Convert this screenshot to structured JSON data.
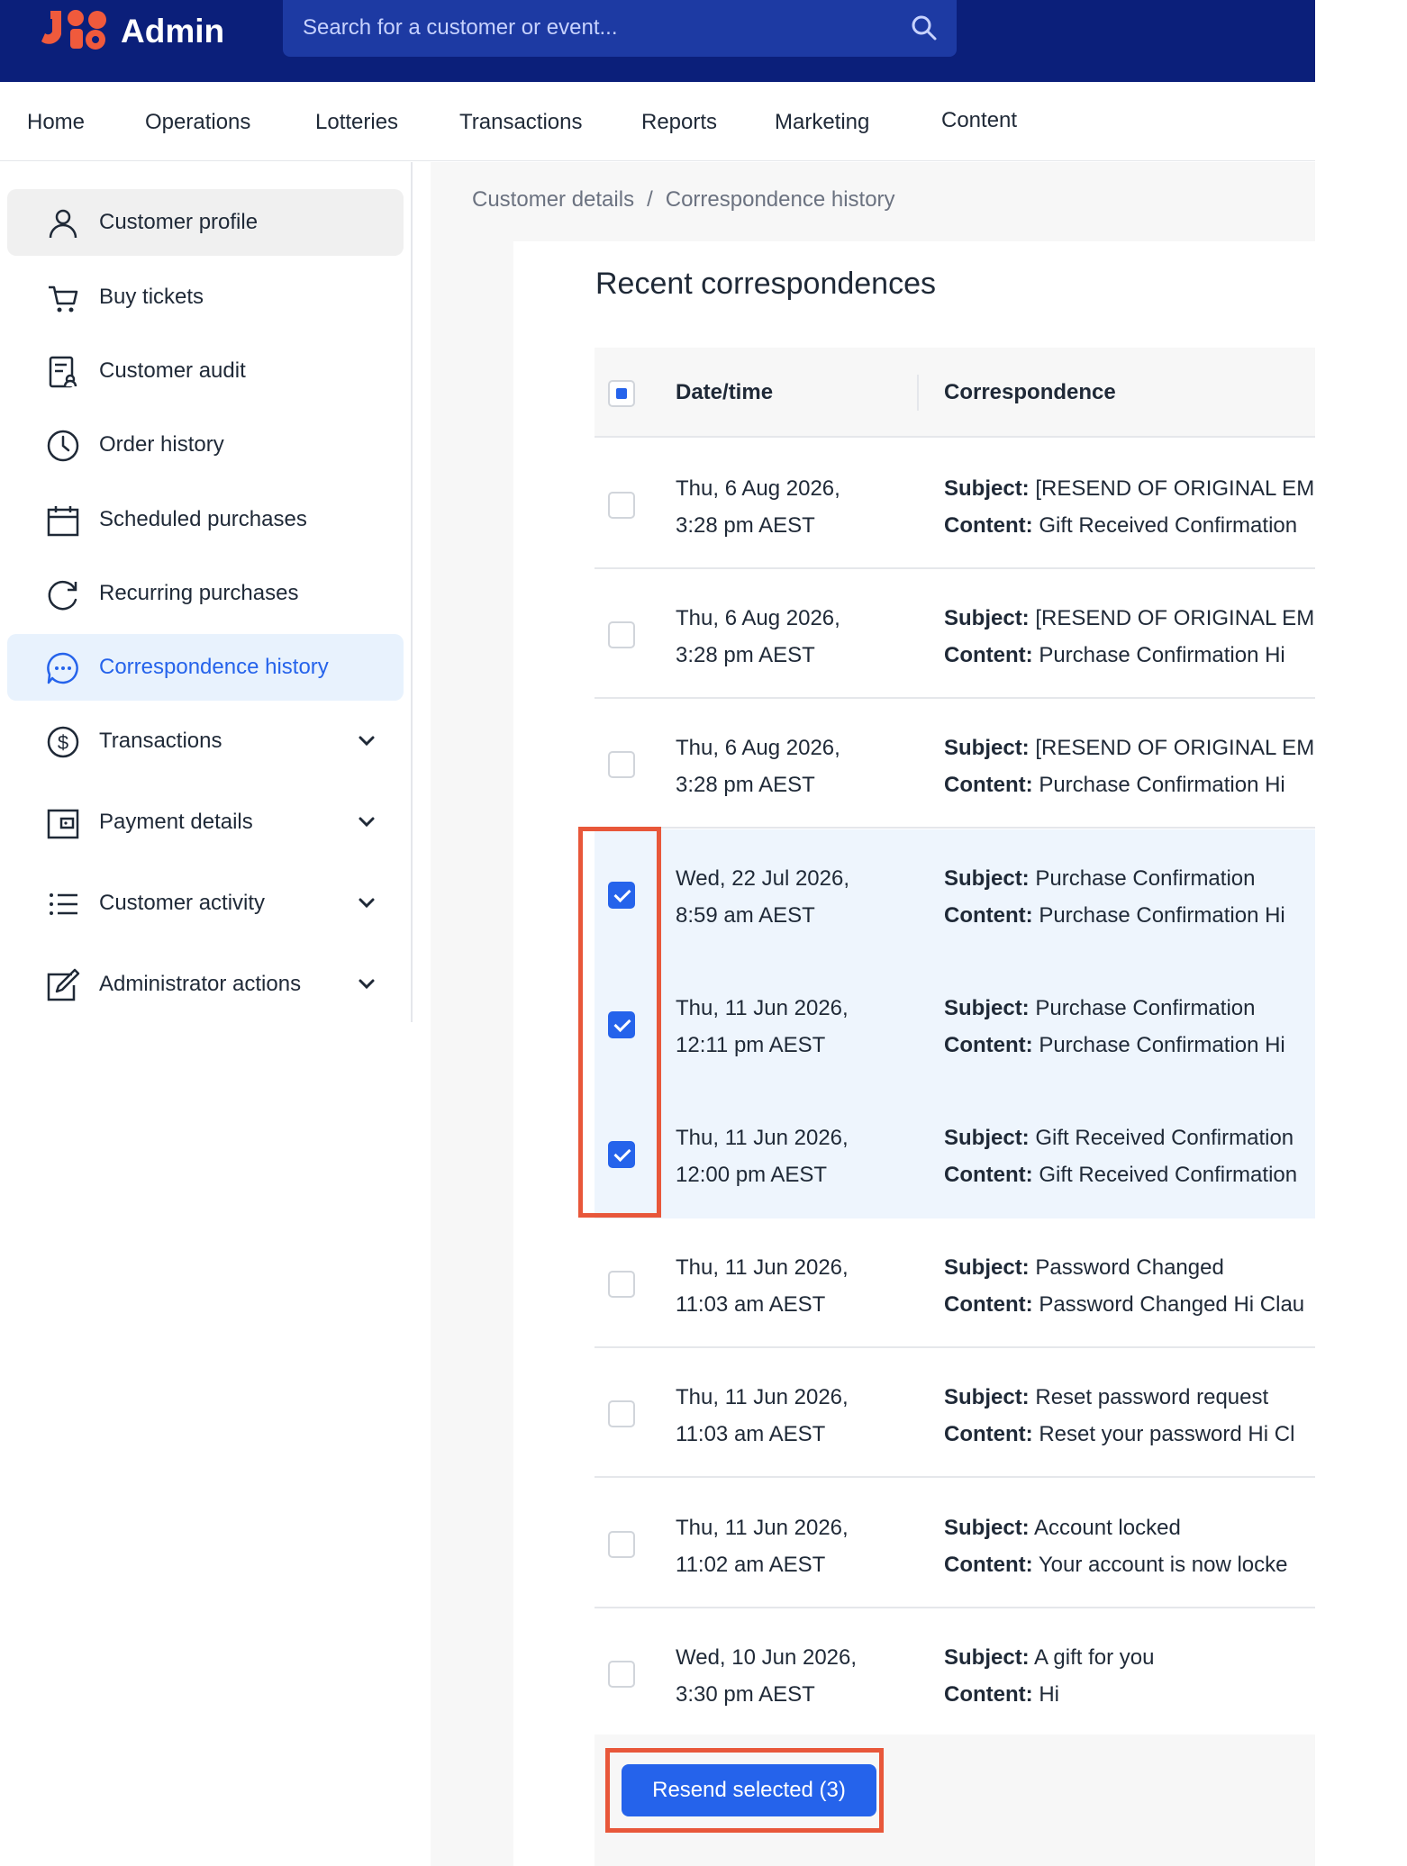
{
  "header": {
    "brand": "Admin",
    "search_placeholder": "Search for a customer or event..."
  },
  "nav": [
    "Home",
    "Operations",
    "Lotteries",
    "Transactions",
    "Reports",
    "Marketing",
    "Content"
  ],
  "sidebar": {
    "items": [
      {
        "label": "Customer profile",
        "icon": "user-icon"
      },
      {
        "label": "Buy tickets",
        "icon": "cart-icon"
      },
      {
        "label": "Customer audit",
        "icon": "audit-icon"
      },
      {
        "label": "Order history",
        "icon": "clock-icon"
      },
      {
        "label": "Scheduled purchases",
        "icon": "calendar-icon"
      },
      {
        "label": "Recurring purchases",
        "icon": "refresh-icon"
      },
      {
        "label": "Correspondence history",
        "icon": "chat-icon"
      },
      {
        "label": "Transactions",
        "icon": "dollar-icon"
      },
      {
        "label": "Payment details",
        "icon": "wallet-icon"
      },
      {
        "label": "Customer activity",
        "icon": "list-icon"
      },
      {
        "label": "Administrator actions",
        "icon": "edit-icon"
      }
    ]
  },
  "breadcrumb": {
    "parent": "Customer details",
    "separator": "/",
    "current": "Correspondence history"
  },
  "panel": {
    "title": "Recent correspondences",
    "columns": {
      "date": "Date/time",
      "correspondence": "Correspondence"
    },
    "subject_label": "Subject:",
    "content_label": "Content:",
    "rows": [
      {
        "date1": "Thu, 6 Aug 2026,",
        "date2": "3:28 pm AEST",
        "subject": "[RESEND OF ORIGINAL EM",
        "content": "Gift Received Confirmation",
        "checked": false
      },
      {
        "date1": "Thu, 6 Aug 2026,",
        "date2": "3:28 pm AEST",
        "subject": "[RESEND OF ORIGINAL EM",
        "content": "Purchase Confirmation Hi",
        "checked": false
      },
      {
        "date1": "Thu, 6 Aug 2026,",
        "date2": "3:28 pm AEST",
        "subject": "[RESEND OF ORIGINAL EM",
        "content": "Purchase Confirmation Hi",
        "checked": false
      },
      {
        "date1": "Wed, 22 Jul 2026,",
        "date2": "8:59 am AEST",
        "subject": "Purchase Confirmation",
        "content": "Purchase Confirmation Hi",
        "checked": true
      },
      {
        "date1": "Thu, 11 Jun 2026,",
        "date2": "12:11 pm AEST",
        "subject": "Purchase Confirmation",
        "content": "Purchase Confirmation Hi",
        "checked": true
      },
      {
        "date1": "Thu, 11 Jun 2026,",
        "date2": "12:00 pm AEST",
        "subject": "Gift Received Confirmation",
        "content": "Gift Received Confirmation",
        "checked": true
      },
      {
        "date1": "Thu, 11 Jun 2026,",
        "date2": "11:03 am AEST",
        "subject": "Password Changed",
        "content": "Password Changed Hi Clau",
        "checked": false
      },
      {
        "date1": "Thu, 11 Jun 2026,",
        "date2": "11:03 am AEST",
        "subject": "Reset password request",
        "content": "Reset your password Hi Cl",
        "checked": false
      },
      {
        "date1": "Thu, 11 Jun 2026,",
        "date2": "11:02 am AEST",
        "subject": "Account locked",
        "content": "Your account is now locke",
        "checked": false
      },
      {
        "date1": "Wed, 10 Jun 2026,",
        "date2": "3:30 pm AEST",
        "subject": "A gift for you",
        "content": "Hi",
        "checked": false
      }
    ],
    "resend_label": "Resend selected (3)"
  },
  "colors": {
    "topbar": "#0b1f7a",
    "accent": "#2563eb",
    "selected_row": "#eef5fd",
    "highlight": "#e8573a"
  }
}
